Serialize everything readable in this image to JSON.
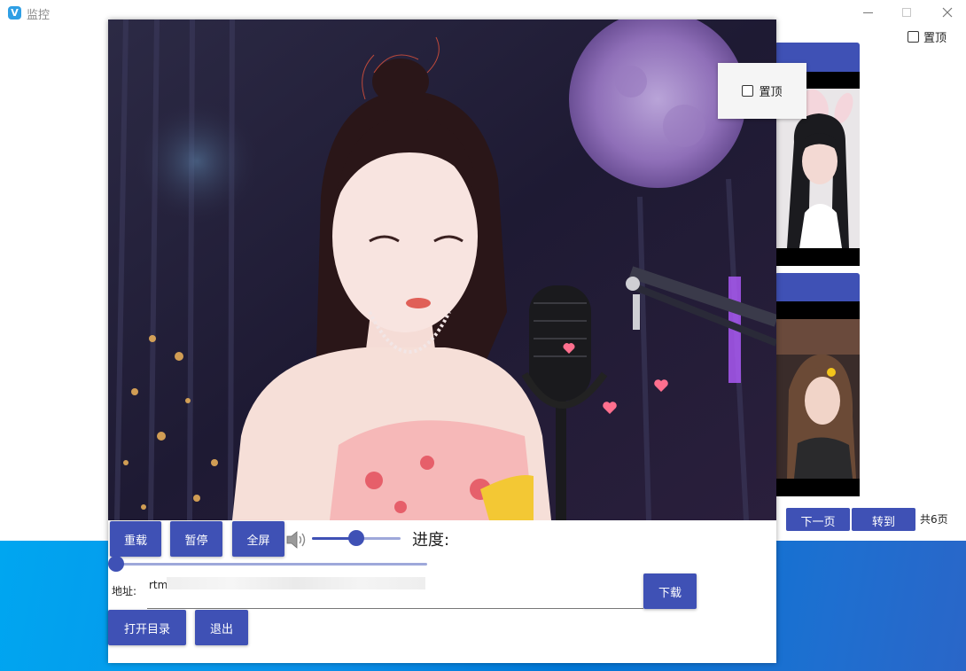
{
  "window": {
    "title": "监控",
    "app_icon_letter": "V",
    "pin_top_label": "置顶"
  },
  "pager": {
    "next_label": "下一页",
    "goto_label": "转到",
    "total_label": "共6页"
  },
  "player": {
    "pin_popup_label": "置顶",
    "buttons": {
      "reload": "重载",
      "pause": "暂停",
      "fullscreen": "全屏",
      "download": "下载",
      "open_dir": "打开目录",
      "exit": "退出"
    },
    "volume": 0.5,
    "progress_label": "进度:",
    "progress": 0,
    "address_label": "地址:",
    "address_value": "rtm"
  },
  "colors": {
    "accent": "#3f51b5",
    "slider_track": "#9ea8da",
    "desktop": "#0a8fe8"
  },
  "icons": [
    "volume-icon",
    "checkbox-icon",
    "minimize-icon",
    "maximize-icon",
    "close-icon"
  ]
}
